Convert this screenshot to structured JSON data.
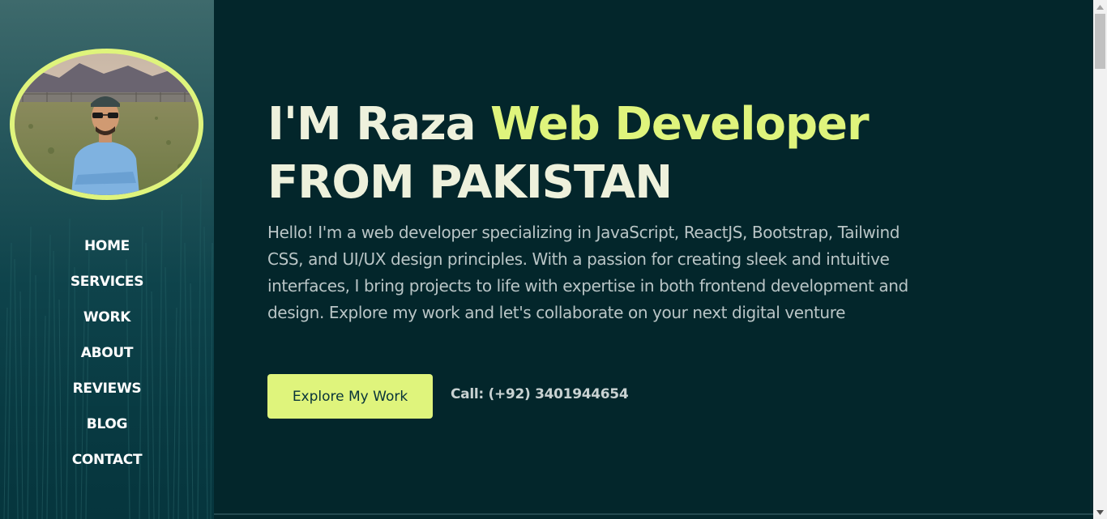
{
  "sidebar": {
    "avatar_alt": "Profile photo",
    "nav": [
      {
        "label": "HOME"
      },
      {
        "label": "SERVICES"
      },
      {
        "label": "WORK"
      },
      {
        "label": "ABOUT"
      },
      {
        "label": "REVIEWS"
      },
      {
        "label": "BLOG"
      },
      {
        "label": "CONTACT"
      }
    ]
  },
  "hero": {
    "heading_part1": "I'M Raza ",
    "heading_accent": "Web Developer",
    "heading_part2": "FROM PAKISTAN",
    "intro": "Hello! I'm a web developer specializing in JavaScript, ReactJS, Bootstrap, Tailwind CSS, and UI/UX design principles. With a passion for creating sleek and intuitive interfaces, I bring projects to life with expertise in both frontend development and design. Explore my work and let's collaborate on your next digital venture",
    "cta_label": "Explore My Work",
    "phone": "Call: (+92) 3401944654"
  },
  "colors": {
    "accent": "#dff47c",
    "background": "#03262b",
    "sidebar": "#0e434b",
    "heading": "#eef1dc",
    "body_text": "#b9c5c6"
  },
  "icons": {
    "scroll_up": "triangle-up-icon",
    "scroll_down": "triangle-down-icon"
  }
}
